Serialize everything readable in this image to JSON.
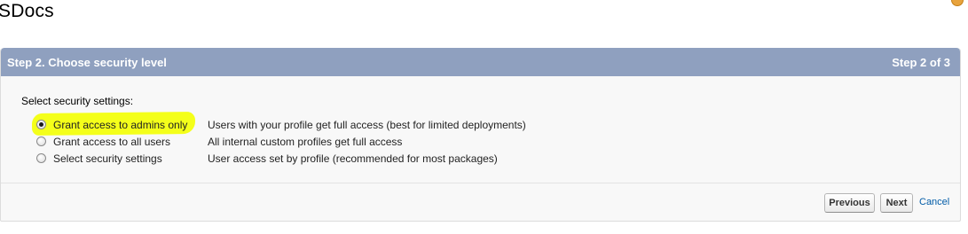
{
  "app": {
    "title": "SDocs"
  },
  "wizard": {
    "header_title": "Step 2. Choose security level",
    "header_step": "Step 2 of 3",
    "prompt": "Select security settings:",
    "options": [
      {
        "label": "Grant access to admins only",
        "description": "Users with your profile get full access (best for limited deployments)",
        "selected": true,
        "highlighted": true
      },
      {
        "label": "Grant access to all users",
        "description": "All internal custom profiles get full access",
        "selected": false,
        "highlighted": false
      },
      {
        "label": "Select security settings",
        "description": "User access set by profile (recommended for most packages)",
        "selected": false,
        "highlighted": false
      }
    ],
    "buttons": {
      "previous": "Previous",
      "next": "Next",
      "cancel": "Cancel"
    }
  },
  "colors": {
    "header_bg": "#8fa0bf",
    "highlight": "#f4ff1a",
    "link": "#015ba7"
  }
}
